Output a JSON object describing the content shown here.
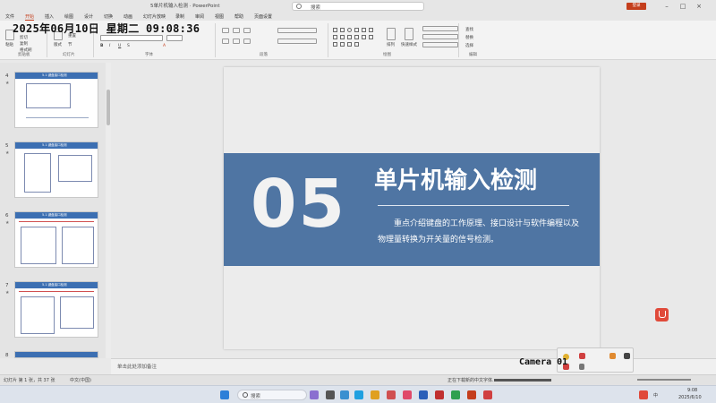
{
  "window": {
    "title": "5单片机输入检测 · PowerPoint",
    "login_label": "登录"
  },
  "search": {
    "label": "搜索"
  },
  "menu_tabs": [
    "文件",
    "开始",
    "插入",
    "绘图",
    "设计",
    "切换",
    "动画",
    "幻灯片放映",
    "录制",
    "审阅",
    "视图",
    "帮助",
    "页面设置"
  ],
  "overlay_clock": "2025年06月10日 星期二 09:08:36",
  "ribbon": {
    "groups": [
      {
        "label": "剪贴板"
      },
      {
        "label": "幻灯片"
      },
      {
        "label": "字体"
      },
      {
        "label": "段落"
      },
      {
        "label": "绘图"
      },
      {
        "label": "编辑"
      }
    ],
    "clipboard": {
      "paste": "粘贴",
      "cut": "剪切",
      "copy": "复制",
      "format": "格式刷"
    },
    "slides": {
      "new_slide": "新建\n幻灯片",
      "layout": "版式",
      "reset": "重置",
      "section": "节"
    },
    "arrange": "排列",
    "quick_styles": "快速样式",
    "editing": {
      "find": "查找",
      "replace": "替换",
      "select": "选择"
    }
  },
  "thumbnails": [
    {
      "number": "4",
      "heading": "5.1 键盘接口检测"
    },
    {
      "number": "5",
      "heading": "5.1 键盘接口检测"
    },
    {
      "number": "6",
      "heading": "5.1 键盘接口检测"
    },
    {
      "number": "7",
      "heading": "5.1 键盘接口检测"
    },
    {
      "number": "8",
      "heading": ""
    }
  ],
  "slide": {
    "number_big": "05",
    "title": "单片机输入检测",
    "description": "重点介绍键盘的工作原理、接口设计与软件编程以及物理量转换为开关量的信号检测。",
    "band_color": "#4f75a3"
  },
  "notes": {
    "placeholder": "单击此处添加备注"
  },
  "status": {
    "slide_counter": "幻灯片 第 1 张，共 37 张",
    "language": "中文(中国)",
    "download_msg": "正在下载新的中文字体..."
  },
  "camera": {
    "label": "Camera 01"
  },
  "taskbar": {
    "search_label": "搜索",
    "tray_lang": "中",
    "time": "9:08",
    "date": "2025/6/10"
  },
  "accent": "#c43e1c"
}
